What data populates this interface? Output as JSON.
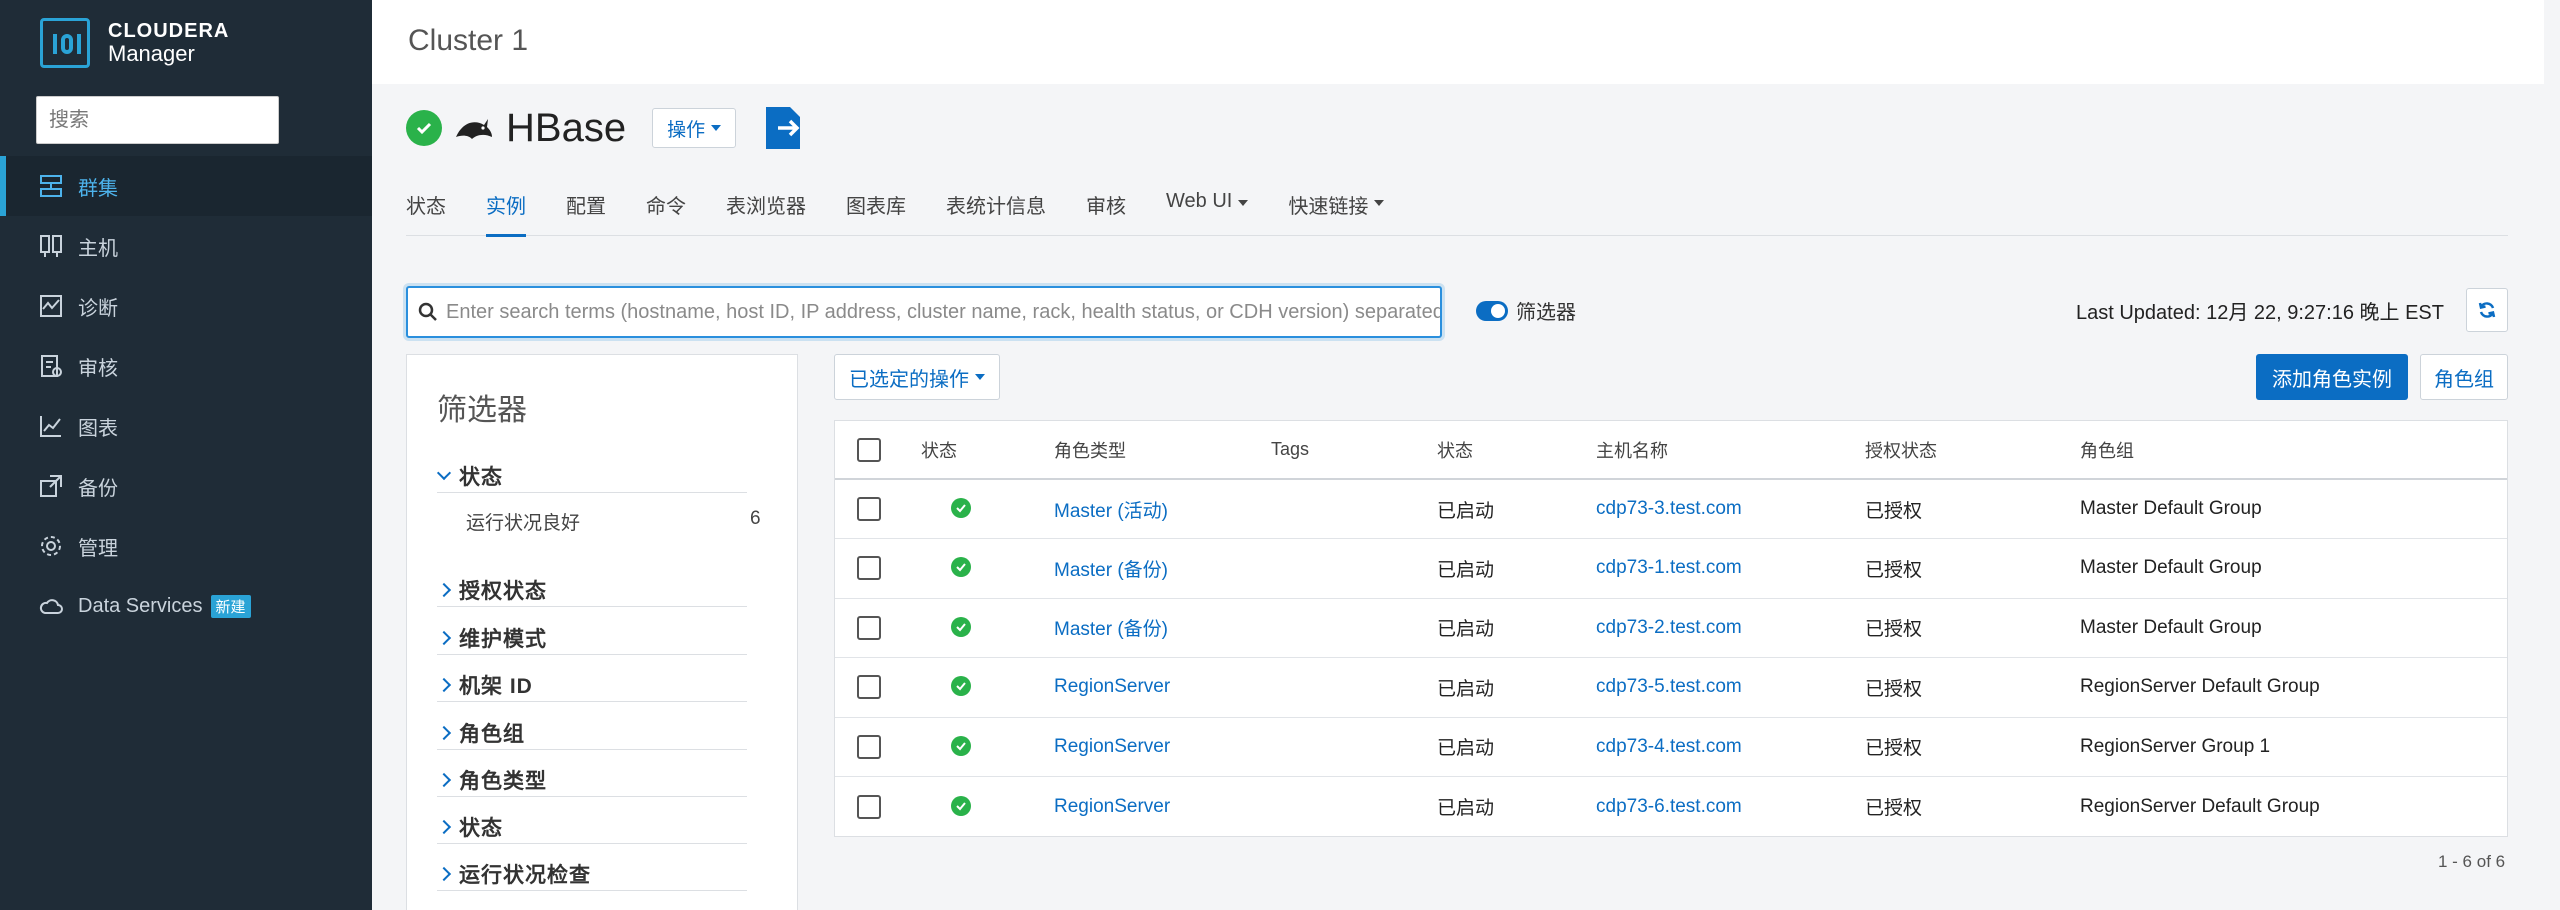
{
  "brand": {
    "line1": "CLOUDERA",
    "line2": "Manager"
  },
  "sidebar": {
    "search_placeholder": "搜索",
    "items": [
      {
        "label": "群集",
        "icon": "cluster-icon"
      },
      {
        "label": "主机",
        "icon": "hosts-icon"
      },
      {
        "label": "诊断",
        "icon": "diagnostics-icon"
      },
      {
        "label": "审核",
        "icon": "audit-icon"
      },
      {
        "label": "图表",
        "icon": "charts-icon"
      },
      {
        "label": "备份",
        "icon": "backup-icon"
      },
      {
        "label": "管理",
        "icon": "gear-icon"
      },
      {
        "label": "Data Services",
        "icon": "cloud-icon",
        "badge": "新建"
      }
    ]
  },
  "topbar": {
    "title": "Cluster 1"
  },
  "service": {
    "name": "HBase",
    "actions_label": "操作"
  },
  "tabs": [
    {
      "label": "状态"
    },
    {
      "label": "实例"
    },
    {
      "label": "配置"
    },
    {
      "label": "命令"
    },
    {
      "label": "表浏览器"
    },
    {
      "label": "图表库"
    },
    {
      "label": "表统计信息"
    },
    {
      "label": "审核"
    },
    {
      "label": "Web UI"
    },
    {
      "label": "快速链接"
    }
  ],
  "search": {
    "placeholder": "Enter search terms (hostname, host ID, IP address, cluster name, rack, health status, or CDH version) separated by spaces",
    "filter_toggle_label": "筛选器"
  },
  "last_updated": "Last Updated: 12月 22, 9:27:16 晚上 EST",
  "filters": {
    "title": "筛选器",
    "sections": [
      {
        "label": "状态",
        "expanded": true
      },
      {
        "label": "授权状态"
      },
      {
        "label": "维护模式"
      },
      {
        "label": "机架 ID"
      },
      {
        "label": "角色组"
      },
      {
        "label": "角色类型"
      },
      {
        "label": "状态"
      },
      {
        "label": "运行状况检查"
      }
    ],
    "health_option": {
      "label": "运行状况良好",
      "count": "6"
    }
  },
  "toolbar": {
    "selected_actions": "已选定的操作",
    "add_role_instance": "添加角色实例",
    "role_groups": "角色组"
  },
  "table": {
    "headers": [
      "状态",
      "角色类型",
      "Tags",
      "状态",
      "主机名称",
      "授权状态",
      "角色组"
    ],
    "rows": [
      {
        "role_type": "Master (活动)",
        "tags": "",
        "state": "已启动",
        "host": "cdp73-3.test.com",
        "commission": "已授权",
        "role_group": "Master Default Group"
      },
      {
        "role_type": "Master (备份)",
        "tags": "",
        "state": "已启动",
        "host": "cdp73-1.test.com",
        "commission": "已授权",
        "role_group": "Master Default Group"
      },
      {
        "role_type": "Master (备份)",
        "tags": "",
        "state": "已启动",
        "host": "cdp73-2.test.com",
        "commission": "已授权",
        "role_group": "Master Default Group"
      },
      {
        "role_type": "RegionServer",
        "tags": "",
        "state": "已启动",
        "host": "cdp73-5.test.com",
        "commission": "已授权",
        "role_group": "RegionServer Default Group"
      },
      {
        "role_type": "RegionServer",
        "tags": "",
        "state": "已启动",
        "host": "cdp73-4.test.com",
        "commission": "已授权",
        "role_group": "RegionServer Group 1"
      },
      {
        "role_type": "RegionServer",
        "tags": "",
        "state": "已启动",
        "host": "cdp73-6.test.com",
        "commission": "已授权",
        "role_group": "RegionServer Default Group"
      }
    ],
    "pager": "1 - 6 of 6"
  },
  "colors": {
    "accent": "#0b6dc3",
    "sidebar_bg": "#1f2c37",
    "ok_green": "#2ab24a"
  }
}
